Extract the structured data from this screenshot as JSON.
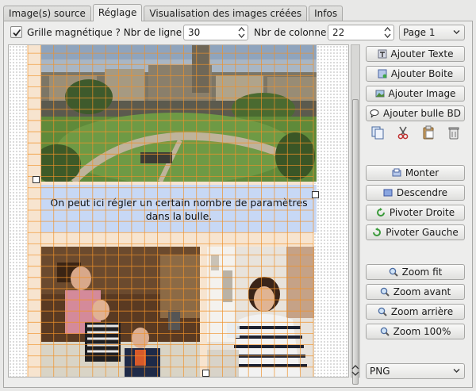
{
  "tabs": [
    {
      "label": "Image(s) source"
    },
    {
      "label": "Réglage"
    },
    {
      "label": "Visualisation des images créées"
    },
    {
      "label": "Infos"
    }
  ],
  "toolbar": {
    "grid_label": "Grille magnétique ? Nbr de ligne :",
    "grid_checked": true,
    "rows_value": "30",
    "cols_label": "Nbr de colonne :",
    "cols_value": "22",
    "page_select": "Page 1"
  },
  "canvas": {
    "bubble_text": "On peut ici régler un certain nombre de paramètres dans la bulle.",
    "grid_color": "#f0922a",
    "bubble_color": "#c7d8f5",
    "page_color": "#f7e4cf"
  },
  "buttons": {
    "add_text": "Ajouter Texte",
    "add_box": "Ajouter Boite",
    "add_image": "Ajouter Image",
    "add_bubble": "Ajouter bulle BD",
    "move_up": "Monter",
    "move_down": "Descendre",
    "rotate_right": "Pivoter Droite",
    "rotate_left": "Pivoter Gauche",
    "zoom_fit": "Zoom fit",
    "zoom_in": "Zoom avant",
    "zoom_out": "Zoom arrière",
    "zoom_100": "Zoom 100%"
  },
  "icons": [
    "copy-icon",
    "cut-icon",
    "paste-icon",
    "delete-icon"
  ],
  "format_select": "PNG"
}
